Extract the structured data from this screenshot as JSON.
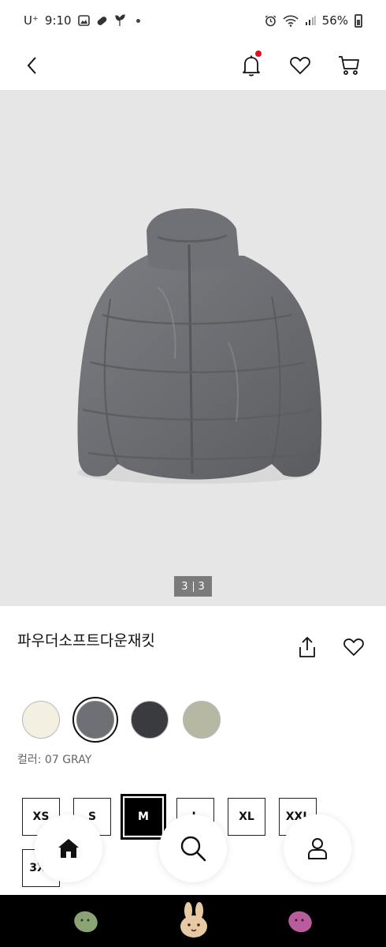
{
  "status_bar": {
    "carrier": "U⁺",
    "time": "9:10",
    "battery": "56%",
    "icons_left": [
      "gallery-icon",
      "pill-icon",
      "plant-icon",
      "more-dot-icon"
    ],
    "icons_right": [
      "alarm-icon",
      "wifi-icon",
      "signal-icon",
      "battery-icon"
    ]
  },
  "nav": {
    "icons": [
      "back-chevron-icon",
      "bell-icon",
      "heart-icon",
      "cart-icon"
    ],
    "notification_badge_color": "#e0101e"
  },
  "image": {
    "counter_current": "3",
    "counter_total": "3",
    "background_color": "#e6e6e6"
  },
  "product": {
    "title": "파우더소프트다운재킷",
    "color_label": "컬러: 07 GRAY",
    "swatches": [
      {
        "name": "off-white",
        "color": "#f3efe1",
        "selected": false
      },
      {
        "name": "gray",
        "color": "#6e7075",
        "selected": true
      },
      {
        "name": "black",
        "color": "#3a3b3e",
        "selected": false
      },
      {
        "name": "olive",
        "color": "#b6b8a3",
        "selected": false
      }
    ]
  },
  "sizes": [
    {
      "label": "XS",
      "selected": false
    },
    {
      "label": "S",
      "selected": false
    },
    {
      "label": "M",
      "selected": true
    },
    {
      "label": "L",
      "selected": false
    },
    {
      "label": "XL",
      "selected": false
    },
    {
      "label": "XXL",
      "selected": false
    },
    {
      "label": "3XL",
      "selected": false
    }
  ],
  "floating_nav": {
    "icons": [
      "home-icon",
      "search-icon",
      "user-icon"
    ]
  },
  "bottom_bar": {
    "icons": [
      "green-bean-icon",
      "bunny-icon",
      "purple-bean-icon"
    ]
  }
}
